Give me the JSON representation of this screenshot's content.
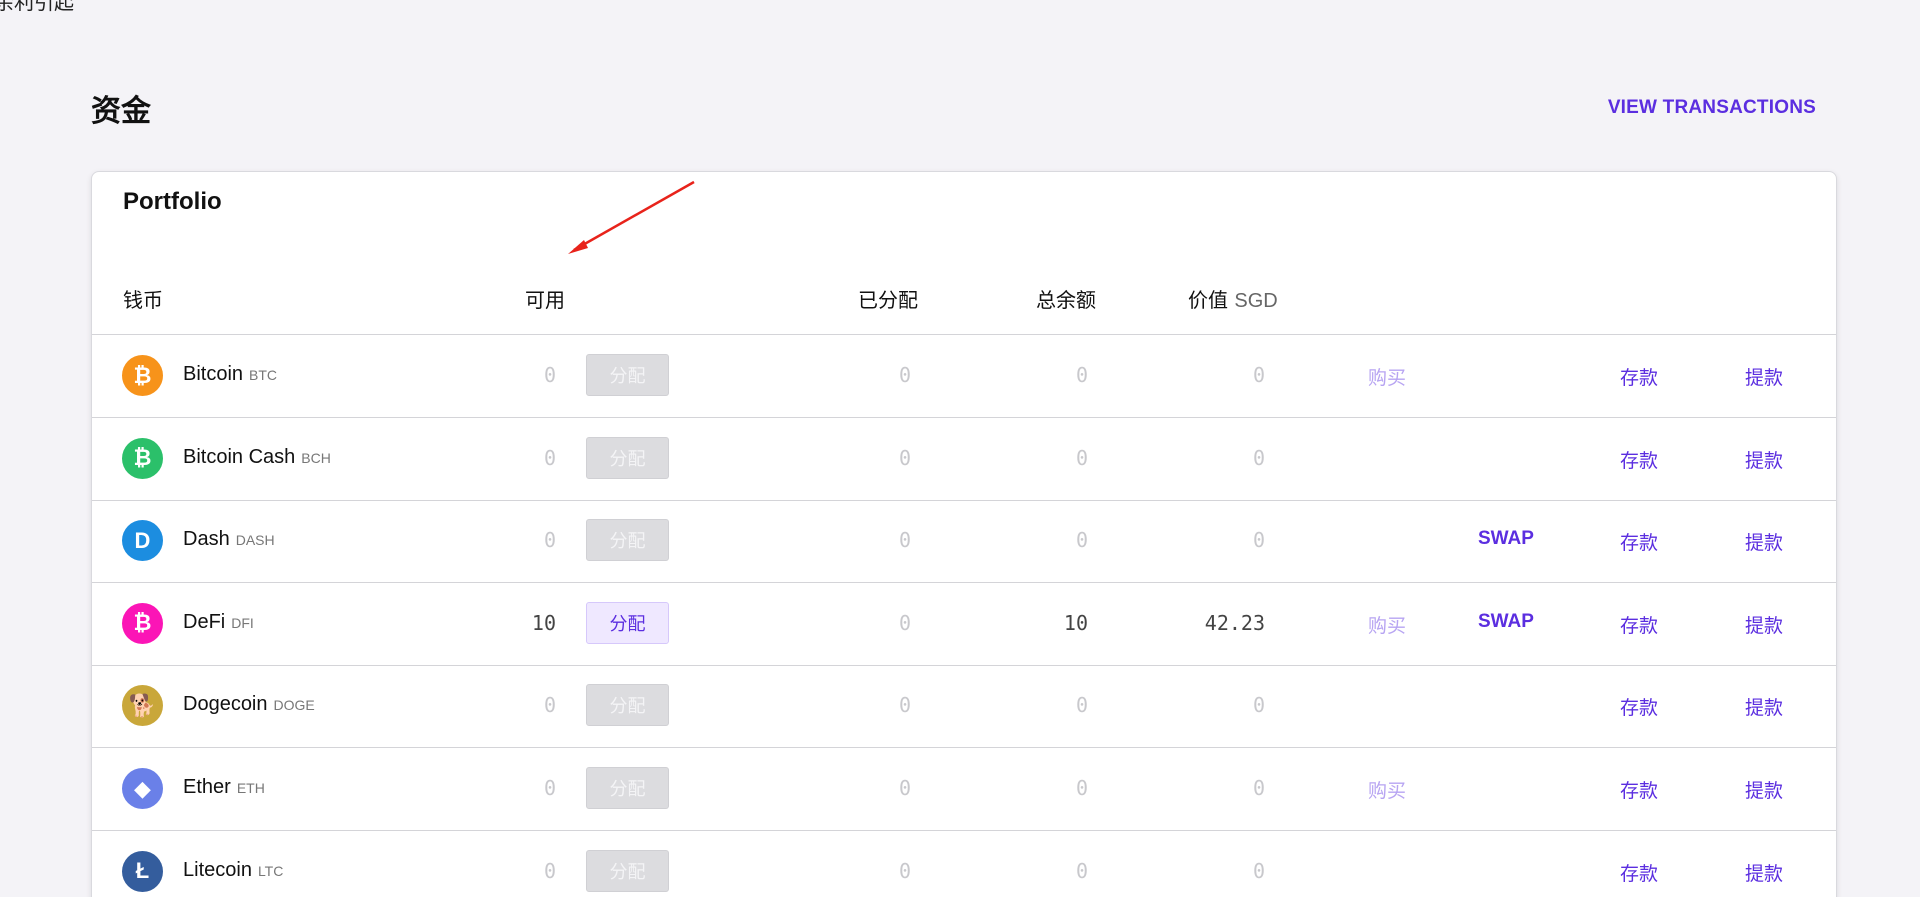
{
  "top_fragment": "余利引起",
  "header": {
    "title": "资金",
    "view_transactions": "VIEW TRANSACTIONS"
  },
  "portfolio": {
    "title": "Portfolio",
    "columns": {
      "currency": "钱币",
      "available": "可用",
      "allocated": "已分配",
      "total": "总余额",
      "value": "价值",
      "value_unit": "SGD"
    },
    "allocate_label": "分配",
    "buy_label": "购买",
    "swap_label": "SWAP",
    "deposit_label": "存款",
    "withdraw_label": "提款",
    "rows": [
      {
        "name": "Bitcoin",
        "symbol": "BTC",
        "available": "0",
        "allocated": "0",
        "total": "0",
        "value": "0",
        "buy": true,
        "swap": false,
        "icon": "bitcoin-icon",
        "color": "#f7931a",
        "glyph": "₿"
      },
      {
        "name": "Bitcoin Cash",
        "symbol": "BCH",
        "available": "0",
        "allocated": "0",
        "total": "0",
        "value": "0",
        "buy": false,
        "swap": false,
        "icon": "bitcoin-cash-icon",
        "color": "#2bc06a",
        "glyph": "₿"
      },
      {
        "name": "Dash",
        "symbol": "DASH",
        "available": "0",
        "allocated": "0",
        "total": "0",
        "value": "0",
        "buy": false,
        "swap": true,
        "icon": "dash-icon",
        "color": "#1c8de0",
        "glyph": "D"
      },
      {
        "name": "DeFi",
        "symbol": "DFI",
        "available": "10",
        "allocated": "0",
        "total": "10",
        "value": "42.23",
        "buy": true,
        "swap": true,
        "icon": "defi-icon",
        "color": "#fb15b6",
        "glyph": "₿"
      },
      {
        "name": "Dogecoin",
        "symbol": "DOGE",
        "available": "0",
        "allocated": "0",
        "total": "0",
        "value": "0",
        "buy": false,
        "swap": false,
        "icon": "dogecoin-icon",
        "color": "#c9a73a",
        "glyph": "🐕"
      },
      {
        "name": "Ether",
        "symbol": "ETH",
        "available": "0",
        "allocated": "0",
        "total": "0",
        "value": "0",
        "buy": true,
        "swap": false,
        "icon": "ether-icon",
        "color": "#6a80e8",
        "glyph": "◆"
      },
      {
        "name": "Litecoin",
        "symbol": "LTC",
        "available": "0",
        "allocated": "0",
        "total": "0",
        "value": "0",
        "buy": false,
        "swap": false,
        "icon": "litecoin-icon",
        "color": "#345d9d",
        "glyph": "Ł"
      }
    ]
  },
  "colors": {
    "accent": "#5b2ee0",
    "accent_muted": "#b7a4f2",
    "annotation_arrow": "#e8231b"
  }
}
